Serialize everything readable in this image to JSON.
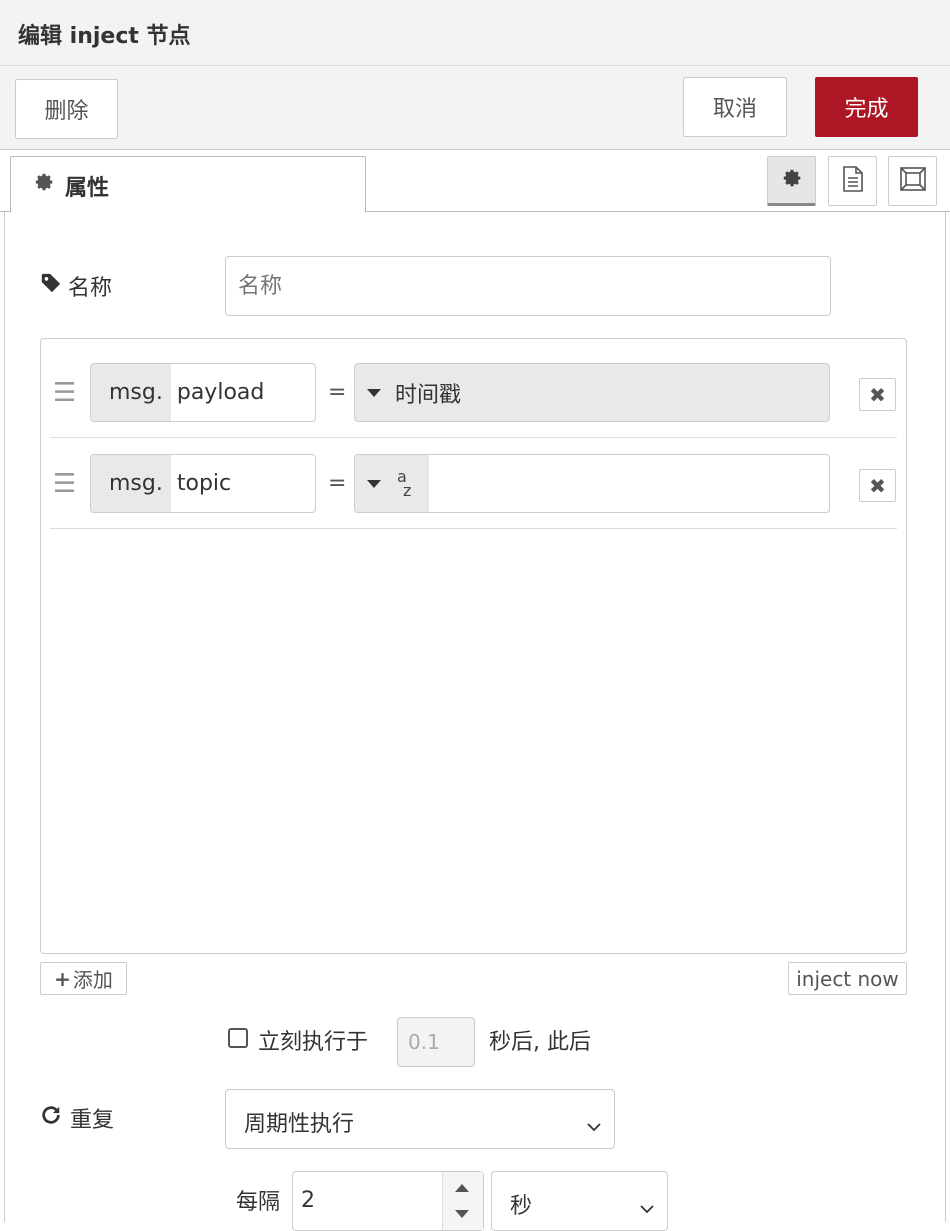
{
  "header": {
    "title": "编辑 inject 节点"
  },
  "toolbar": {
    "delete_label": "删除",
    "cancel_label": "取消",
    "done_label": "完成",
    "accent": "#ad1625"
  },
  "tabs": {
    "properties_label": "属性"
  },
  "name_field": {
    "label": "名称",
    "placeholder": "名称",
    "value": ""
  },
  "properties": [
    {
      "prefix": "msg.",
      "property": "payload",
      "operator": "=",
      "type_label": "时间戳",
      "value": ""
    },
    {
      "prefix": "msg.",
      "property": "topic",
      "operator": "=",
      "type_label": "",
      "type_icon": "string-az-icon",
      "value": ""
    }
  ],
  "buttons": {
    "add_label": "添加",
    "inject_now_label": "inject now"
  },
  "once": {
    "label": "立刻执行于",
    "delay_placeholder": "0.1",
    "suffix": "秒后, 此后",
    "checked": false
  },
  "repeat": {
    "label": "重复",
    "selected": "周期性执行"
  },
  "interval": {
    "label": "每隔",
    "value": "2",
    "unit": "秒"
  }
}
